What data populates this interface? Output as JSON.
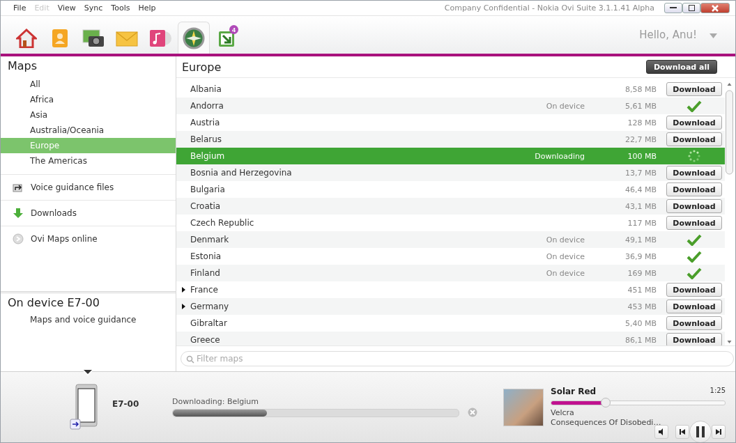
{
  "menu": [
    {
      "label": "File",
      "disabled": false
    },
    {
      "label": "Edit",
      "disabled": true
    },
    {
      "label": "View",
      "disabled": false
    },
    {
      "label": "Sync",
      "disabled": false
    },
    {
      "label": "Tools",
      "disabled": false
    },
    {
      "label": "Help",
      "disabled": false
    }
  ],
  "window": {
    "title": "Company Confidential - Nokia Ovi Suite 3.1.1.41 Alpha"
  },
  "toolbar": {
    "tabs": [
      {
        "kind": "home",
        "selected": false
      },
      {
        "kind": "contacts",
        "selected": false
      },
      {
        "kind": "photos",
        "selected": false
      },
      {
        "kind": "messages",
        "selected": false
      },
      {
        "kind": "music",
        "selected": false
      },
      {
        "kind": "maps",
        "selected": true
      },
      {
        "kind": "updates",
        "selected": false,
        "badge": "4"
      }
    ],
    "greeting": "Hello, Anu!"
  },
  "sidebar": {
    "title": "Maps",
    "regions": [
      {
        "label": "All",
        "selected": false
      },
      {
        "label": "Africa",
        "selected": false
      },
      {
        "label": "Asia",
        "selected": false
      },
      {
        "label": "Australia/Oceania",
        "selected": false
      },
      {
        "label": "Europe",
        "selected": true
      },
      {
        "label": "The Americas",
        "selected": false
      }
    ],
    "links": [
      {
        "kind": "voice",
        "label": "Voice guidance files"
      },
      {
        "kind": "downloads",
        "label": "Downloads"
      },
      {
        "kind": "online",
        "label": "Ovi Maps online"
      }
    ],
    "device": {
      "title": "On device E7-00",
      "items": [
        "Maps and voice guidance"
      ]
    }
  },
  "content": {
    "title": "Europe",
    "download_all": "Download all",
    "rows": [
      {
        "name": "Albania",
        "size": "8,58 MB",
        "kind": "download",
        "button": "Download",
        "expandable": false,
        "selected": false
      },
      {
        "name": "Andorra",
        "status": "On device",
        "size": "5,61 MB",
        "kind": "on_device",
        "expandable": false,
        "selected": false
      },
      {
        "name": "Austria",
        "size": "128 MB",
        "kind": "download",
        "button": "Download",
        "expandable": false,
        "selected": false
      },
      {
        "name": "Belarus",
        "size": "22,7 MB",
        "kind": "download",
        "button": "Download",
        "expandable": false,
        "selected": false
      },
      {
        "name": "Belgium",
        "status": "Downloading",
        "size": "100 MB",
        "kind": "downloading",
        "expandable": false,
        "selected": true
      },
      {
        "name": "Bosnia and Herzegovina",
        "size": "13,7 MB",
        "kind": "download",
        "button": "Download",
        "expandable": false,
        "selected": false
      },
      {
        "name": "Bulgaria",
        "size": "46,4 MB",
        "kind": "download",
        "button": "Download",
        "expandable": false,
        "selected": false
      },
      {
        "name": "Croatia",
        "size": "43,1 MB",
        "kind": "download",
        "button": "Download",
        "expandable": false,
        "selected": false
      },
      {
        "name": "Czech Republic",
        "size": "117 MB",
        "kind": "download",
        "button": "Download",
        "expandable": false,
        "selected": false
      },
      {
        "name": "Denmark",
        "status": "On device",
        "size": "49,1 MB",
        "kind": "on_device",
        "expandable": false,
        "selected": false
      },
      {
        "name": "Estonia",
        "status": "On device",
        "size": "36,9 MB",
        "kind": "on_device",
        "expandable": false,
        "selected": false
      },
      {
        "name": "Finland",
        "status": "On device",
        "size": "169 MB",
        "kind": "on_device",
        "expandable": false,
        "selected": false
      },
      {
        "name": "France",
        "size": "451 MB",
        "kind": "download",
        "button": "Download",
        "expandable": true,
        "selected": false
      },
      {
        "name": "Germany",
        "size": "453 MB",
        "kind": "download",
        "button": "Download",
        "expandable": true,
        "selected": false
      },
      {
        "name": "Gibraltar",
        "size": "5,40 MB",
        "kind": "download",
        "button": "Download",
        "expandable": false,
        "selected": false
      },
      {
        "name": "Greece",
        "size": "86,1 MB",
        "kind": "download",
        "button": "Download",
        "expandable": false,
        "selected": false
      }
    ],
    "filter": {
      "placeholder": "Filter maps"
    }
  },
  "bottom": {
    "device_name": "E7-00",
    "download": {
      "label": "Downloading: Belgium",
      "level": 0.33
    },
    "player": {
      "title": "Solar Red",
      "time": "1:25",
      "level": 0.31,
      "artist": "Velcra",
      "album": "Consequences Of Disobedi…"
    }
  }
}
